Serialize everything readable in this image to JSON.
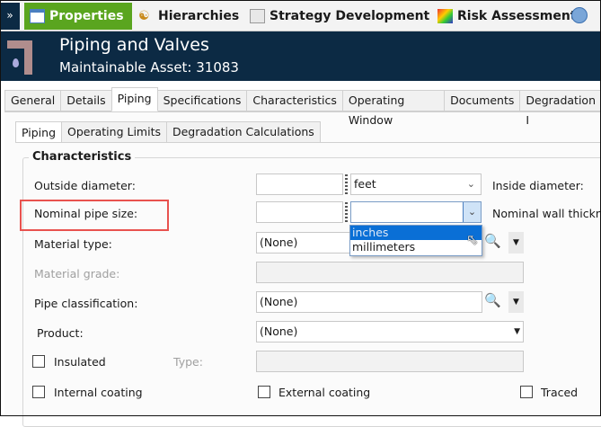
{
  "nav": {
    "tabs": [
      {
        "label": "Properties",
        "active": true
      },
      {
        "label": "Hierarchies"
      },
      {
        "label": "Strategy Development"
      },
      {
        "label": "Risk Assessment"
      }
    ],
    "active_color": "#5aa51f"
  },
  "header": {
    "title": "Piping and Valves",
    "subtitle": "Maintainable Asset:  31083"
  },
  "tabs": [
    "General",
    "Details",
    "Piping",
    "Specifications",
    "Characteristics",
    "Operating Window",
    "Documents",
    "Degradation I"
  ],
  "subtabs": [
    "Piping",
    "Operating Limits",
    "Degradation Calculations"
  ],
  "group": {
    "title": "Characteristics"
  },
  "fields": {
    "outside_diameter": {
      "label": "Outside diameter:",
      "unit": "feet"
    },
    "inside_diameter": {
      "label": "Inside diameter:"
    },
    "nominal_pipe_size": {
      "label": "Nominal pipe size:",
      "unit": "",
      "options": [
        "inches",
        "millimeters"
      ],
      "highlighted": "inches"
    },
    "nominal_wall": {
      "label": "Nominal wall thickne"
    },
    "material_type": {
      "label": "Material type:",
      "value": "(None)"
    },
    "material_grade": {
      "label": "Material grade:"
    },
    "pipe_classification": {
      "label": "Pipe classification:",
      "value": "(None)"
    },
    "product": {
      "label": "Product:",
      "value": "(None)"
    },
    "insulated": {
      "label": "Insulated",
      "checked": false
    },
    "type": {
      "label": "Type:"
    },
    "internal_coating": {
      "label": "Internal coating",
      "checked": false
    },
    "external_coating": {
      "label": "External coating",
      "checked": false
    },
    "traced": {
      "label": "Traced",
      "checked": false
    }
  },
  "highlight_color": "#e8524f"
}
